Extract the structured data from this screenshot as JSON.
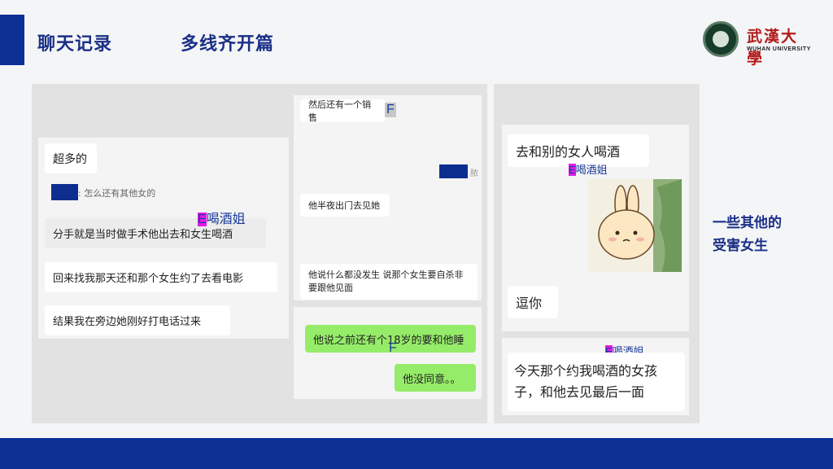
{
  "header": {
    "title": "聊天记录",
    "subtitle": "多线齐开篇"
  },
  "logo": {
    "cn": "武漢大學",
    "en": "WUHAN UNIVERSITY"
  },
  "chat1": {
    "m1": "超多的",
    "quote": ": 怎么还有其他女的",
    "m2": "分手就是当时做手术他出去和女生喝酒",
    "m3": "回来找我那天还和那个女生约了去看电影",
    "m4": "结果我在旁边她刚好打电话过来",
    "tag_letter": "E",
    "tag_label": "喝酒姐"
  },
  "chat2": {
    "m1": "然后还有一个销售",
    "m1_tag": "F",
    "redacted_suffix": "脓",
    "m2": "他半夜出门去见她",
    "m3": "他说什么都没发生 说那个女生要自杀非要跟他见面",
    "m4": "他说之前还有个18岁的要和他睡",
    "m4_tag": "F",
    "m5": "他没同意。。"
  },
  "chat3": {
    "m1": "去和别的女人喝酒",
    "tag_letter": "E",
    "tag_label": "喝酒姐",
    "m2": "逗你"
  },
  "chat4": {
    "tag_letter": "E",
    "tag_label": "喝酒姐",
    "m1": "今天那个约我喝酒的女孩子，和他去见最后一面"
  },
  "note": {
    "line1": "一些其他的",
    "line2": "受害女生"
  },
  "colors": {
    "brand": "#0b2f93",
    "highlight": "#e11be8",
    "wechat_green": "#95ec69"
  }
}
